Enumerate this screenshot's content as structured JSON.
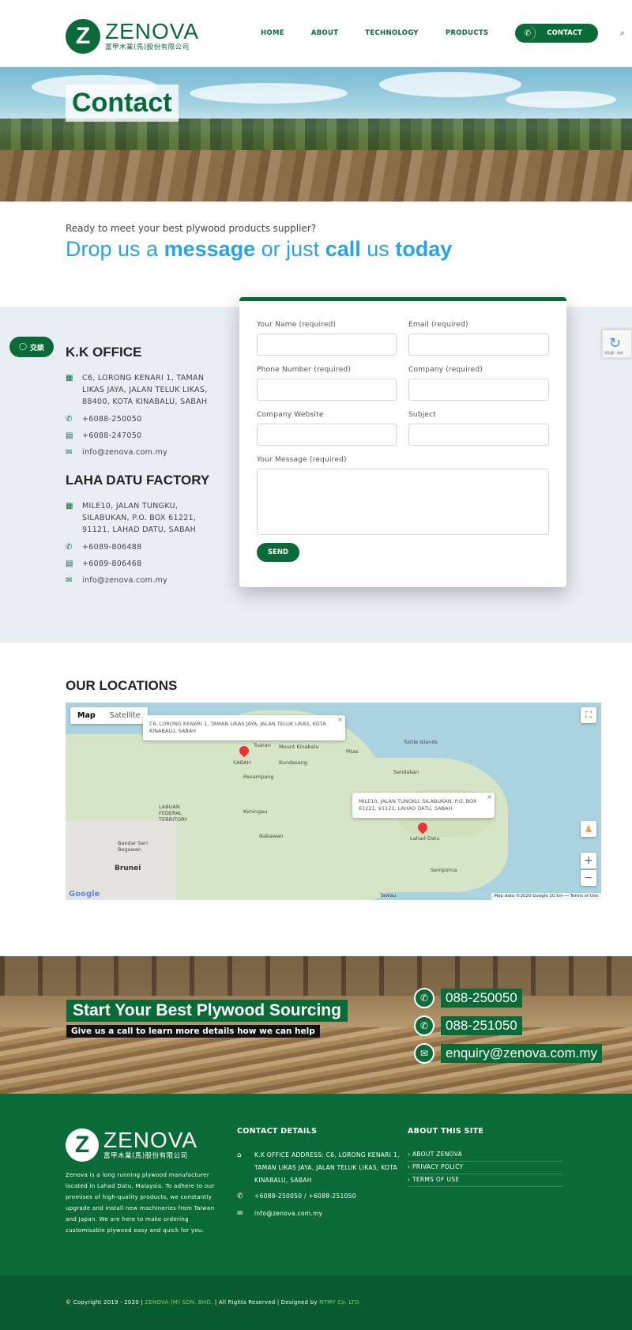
{
  "brand": {
    "logo_letter": "Z",
    "name": "ZENOVA",
    "subtitle": "富甲木業(馬)股份有限公司",
    "color": "#0b6b38"
  },
  "nav": {
    "items": [
      {
        "label": "HOME"
      },
      {
        "label": "ABOUT"
      },
      {
        "label": "TECHNOLOGY"
      },
      {
        "label": "PRODUCTS"
      }
    ],
    "contact_label": "CONTACT",
    "phone_icon": "phone-icon",
    "search_icon": "search-icon"
  },
  "hero": {
    "title": "Contact"
  },
  "intro": {
    "small": "Ready to meet your best plywood products supplier?",
    "big_parts": [
      "Drop us a ",
      "message",
      " or just ",
      "call",
      " us ",
      "today"
    ],
    "accent_color": "#2aa2e8"
  },
  "chat": {
    "label": "交談"
  },
  "offices": [
    {
      "title": "K.K OFFICE",
      "address": "C6, LORONG KENARI 1, TAMAN LIKAS JAYA, JALAN TELUK LIKAS, 88400, KOTA KINABALU, SABAH",
      "phone": "+6088-250050",
      "fax": "+6088-247050",
      "email": "info@zenova.com.my"
    },
    {
      "title": "LAHA DATU FACTORY",
      "address": "MILE10, JALAN TUNGKU, SILABUKAN, P.O. BOX 61221, 91121, LAHAD DATU, SABAH",
      "phone": "+6089-806488",
      "fax": "+6089-806468",
      "email": "info@zenova.com.my"
    }
  ],
  "form": {
    "name_label": "Your Name (required)",
    "email_label": "Email (required)",
    "phone_label": "Phone Number (required)",
    "company_label": "Company (required)",
    "website_label": "Company Website",
    "subject_label": "Subject",
    "message_label": "Your Message (required)",
    "send_label": "SEND"
  },
  "recaptcha": {
    "text": "隱私權 - 條款"
  },
  "locations": {
    "title": "OUR LOCATIONS",
    "tab_map": "Map",
    "tab_satellite": "Satellite",
    "popup1": "C6, LORONG KENARI 1, TAMAN LIKAS JAYA, JALAN TELUK LIKAS, KOTA KINABALU, SABAH",
    "popup2": "MILE10, JALAN TUNGKU, SILABUKAN, P.O. BOX 61221, 91121, LAHAD DATU, SABAH",
    "labels": {
      "sabah": "SABAH",
      "mount": "Mount Kinabalu",
      "tuaran": "Tuaran",
      "kundasang": "Kundasang",
      "penampang": "Penampang",
      "keningau": "Keningau",
      "labuan": "LABUAN FEDERAL TERRITORY",
      "bandar": "Bandar Seri Begawan",
      "brunei": "Brunei",
      "sandakan": "Sandakan",
      "laha": "Lahad Datu",
      "semporna": "Semporna",
      "tawau": "Tawau",
      "nabawan": "Nabawan",
      "turtle": "Turtle Islands",
      "pitas": "Pitas"
    },
    "footer": "Map data ©2020 Google   20 km ⎯⎯   Terms of Use",
    "google": "Google",
    "zoom_in": "+",
    "zoom_out": "−",
    "fullscreen": "⛶"
  },
  "cta": {
    "title": "Start Your Best Plywood Sourcing",
    "subtitle": "Give us a call to learn more details how we can help",
    "phone1": "088-250050",
    "phone2": "088-251050",
    "email": "enquiry@zenova.com.my"
  },
  "footer": {
    "about": "Zenova is a long running plywood manufacturer located in Lahad Datu, Malaysia. To adhere to our promises of high-quality products, we constantly upgrade and install new machineries from Taiwan and Japan. We are here to make ordering customisable plywood easy and quick for you.",
    "contact_head": "CONTACT DETAILS",
    "address": "K.K OFFICE ADDRESS: C6, LORONG KENARI 1, TAMAN LIKAS JAYA, JALAN TELUK LIKAS, KOTA KINABALU, SABAH",
    "phones": "+6088-250050 / +6088-251050",
    "email": "info@zenova.com.my",
    "about_head": "ABOUT THIS SITE",
    "links": [
      "› ABOUT ZENOVA",
      "› PRIVACY POLICY",
      "› TERMS OF USE"
    ],
    "copyright_pre": "© Copyright 2019 - 2020 | ",
    "copyright_company": "ZENOVA (M) SDN. BHD.",
    "copyright_mid": " | All Rights Reserved | Designed by ",
    "copyright_designer": "NTMY Co. LTD."
  }
}
